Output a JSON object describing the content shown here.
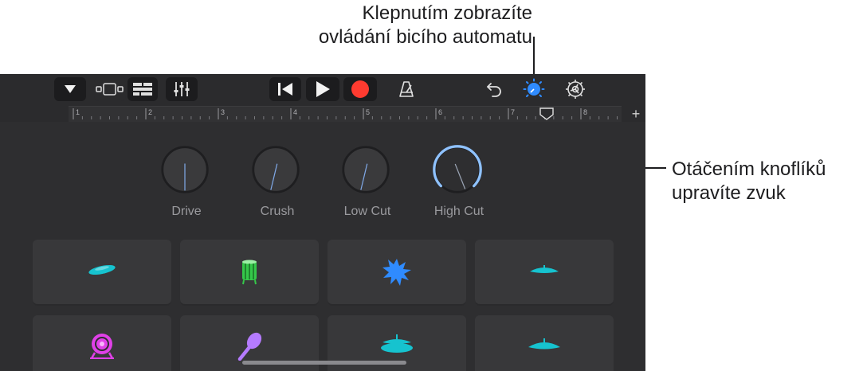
{
  "callouts": {
    "top_line1": "Klepnutím zobrazíte",
    "top_line2": "ovládání bicího automatu",
    "right_line1": "Otáčením knoflíků",
    "right_line2": "upravíte zvuk"
  },
  "ruler": {
    "marks": [
      "1",
      "2",
      "3",
      "4",
      "5",
      "6",
      "7",
      "8"
    ],
    "plus": "+"
  },
  "knobs": [
    {
      "label": "Drive",
      "value": 0.5
    },
    {
      "label": "Crush",
      "value": 0.55
    },
    {
      "label": "Low Cut",
      "value": 0.55
    },
    {
      "label": "High Cut",
      "value": 0.42,
      "active": true
    }
  ],
  "pads": [
    {
      "icon": "snare-drum-icon",
      "color": "#16c3cf"
    },
    {
      "icon": "tom-drum-icon",
      "color": "#35c84a"
    },
    {
      "icon": "clap-burst-icon",
      "color": "#2f8bff"
    },
    {
      "icon": "hihat-closed-icon",
      "color": "#16c3cf"
    },
    {
      "icon": "kick-drum-icon",
      "color": "#e040e8"
    },
    {
      "icon": "maraca-icon",
      "color": "#b57bff"
    },
    {
      "icon": "hihat-icon",
      "color": "#16c3cf"
    },
    {
      "icon": "cymbal-icon",
      "color": "#16c3cf"
    }
  ],
  "colors": {
    "accent_blue": "#2f8bff",
    "record_red": "#ff3b30",
    "knob_active": "#8fc2ff"
  }
}
